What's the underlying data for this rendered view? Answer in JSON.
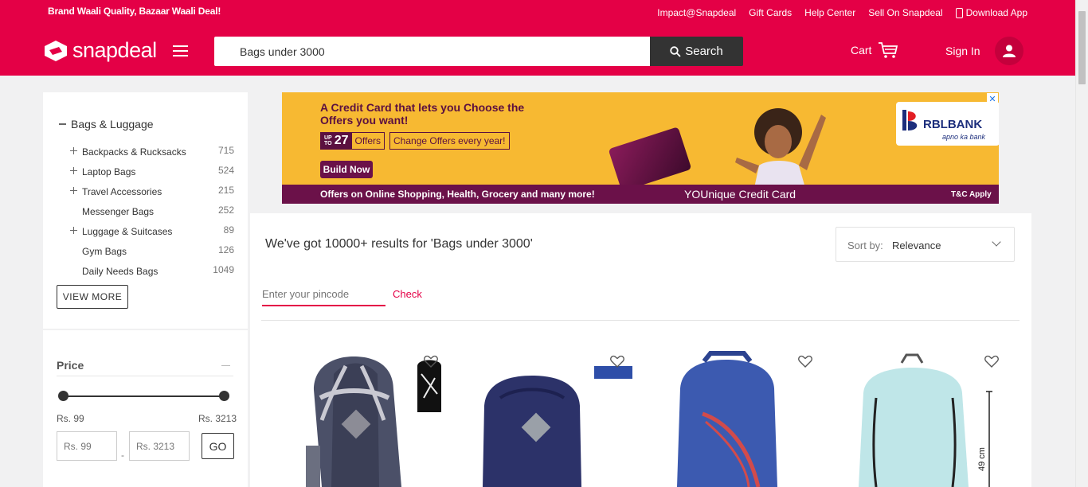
{
  "topbar": {
    "promo": "Brand Waali Quality, Bazaar Waali Deal!",
    "links": [
      "Impact@Snapdeal",
      "Gift Cards",
      "Help Center",
      "Sell On Snapdeal"
    ],
    "download": "Download App"
  },
  "header": {
    "logo": "snapdeal",
    "search_value": "Bags under 3000",
    "search_button": "Search",
    "cart": "Cart",
    "signin": "Sign In"
  },
  "sidebar": {
    "category_title": "Bags & Luggage",
    "categories": [
      {
        "name": "Backpacks & Rucksacks",
        "count": "715",
        "expandable": true
      },
      {
        "name": "Laptop Bags",
        "count": "524",
        "expandable": true
      },
      {
        "name": "Travel Accessories",
        "count": "215",
        "expandable": true
      },
      {
        "name": "Messenger Bags",
        "count": "252",
        "expandable": false
      },
      {
        "name": "Luggage & Suitcases",
        "count": "89",
        "expandable": true
      },
      {
        "name": "Gym Bags",
        "count": "126",
        "expandable": false
      },
      {
        "name": "Daily Needs Bags",
        "count": "1049",
        "expandable": false
      }
    ],
    "view_more": "VIEW MORE",
    "price": {
      "title": "Price",
      "min_label": "Rs. 99",
      "max_label": "Rs. 3213",
      "min_placeholder": "Rs. 99",
      "max_placeholder": "Rs. 3213",
      "go": "GO",
      "dash": "-"
    }
  },
  "banner": {
    "headline": "A Credit Card that lets you Choose the Offers you want!",
    "upto_top": "UP",
    "upto_bottom": "TO",
    "offer_count": "27",
    "offers_label": "Offers",
    "change_offers": "Change Offers every year!",
    "cta": "Build Now",
    "strip_left": "Offers on Online Shopping, Health, Grocery and many more!",
    "strip_mid": "YOUnique Credit Card",
    "strip_right": "T&C Apply",
    "bank": "RBLBANK",
    "bank_tagline": "apno ka bank",
    "close": "✕"
  },
  "results": {
    "title": "We've got 10000+ results for 'Bags under 3000'",
    "sort_label": "Sort by:",
    "sort_value": "Relevance",
    "pincode_placeholder": "Enter your pincode",
    "check": "Check",
    "size_label": "49 cm"
  },
  "colors": {
    "brand": "#e40046",
    "dark": "#333333"
  }
}
